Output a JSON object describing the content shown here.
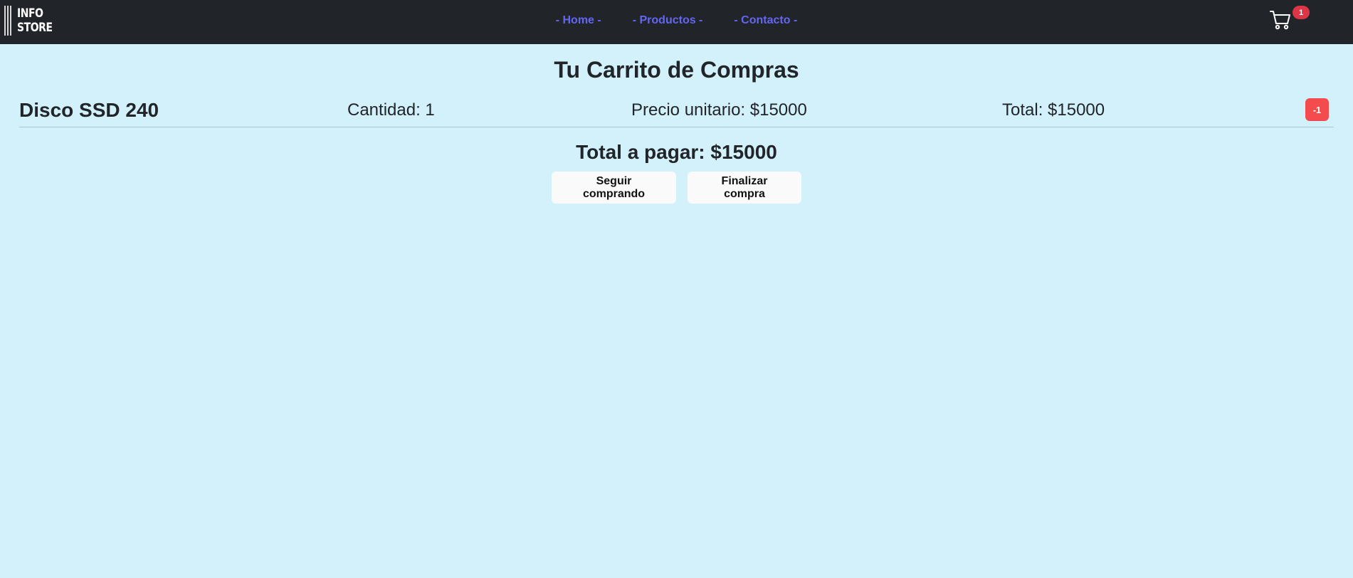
{
  "brand": {
    "logo_line1": "INFO",
    "logo_line2": "STORE"
  },
  "nav": {
    "links": [
      "- Home -",
      "- Productos -",
      "- Contacto -"
    ]
  },
  "cart_icon": {
    "icon": "shopping-cart-icon",
    "count": "1",
    "badge_color": "#dc3545"
  },
  "page": {
    "title": "Tu Carrito de Compras",
    "background": "#d3f1fb"
  },
  "cart": {
    "items": [
      {
        "name": "Disco SSD 240",
        "quantity": "Cantidad: 1",
        "unit_price": "Precio unitario: $15000",
        "total": "Total: $15000",
        "remove_label": "-1"
      }
    ],
    "grand_total": "Total a pagar: $15000"
  },
  "actions": {
    "continue_label": "Seguir comprando",
    "checkout_label": "Finalizar compra"
  },
  "colors": {
    "navbar": "#212529",
    "nav_link": "#6366f1",
    "remove_button": "#f44c4e"
  }
}
